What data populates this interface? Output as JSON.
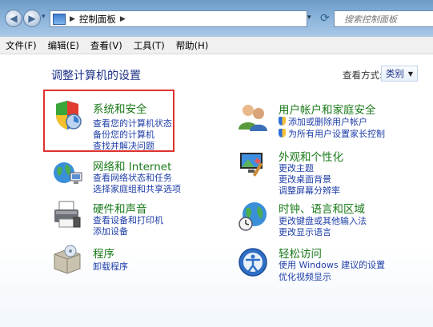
{
  "address": {
    "crumb": "控制面板"
  },
  "search": {
    "placeholder": "搜索控制面板"
  },
  "menubar": [
    "文件(F)",
    "编辑(E)",
    "查看(V)",
    "工具(T)",
    "帮助(H)"
  ],
  "page": {
    "title": "调整计算机的设置",
    "view_by_label": "查看方式:",
    "view_by_value": "类别"
  },
  "categories": {
    "system_security": {
      "title": "系统和安全",
      "links": [
        "查看您的计算机状态",
        "备份您的计算机",
        "查找并解决问题"
      ]
    },
    "network": {
      "title": "网络和 Internet",
      "links": [
        "查看网络状态和任务",
        "选择家庭组和共享选项"
      ]
    },
    "hardware": {
      "title": "硬件和声音",
      "links": [
        "查看设备和打印机",
        "添加设备"
      ]
    },
    "programs": {
      "title": "程序",
      "links": [
        "卸载程序"
      ]
    },
    "user_accounts": {
      "title": "用户帐户和家庭安全",
      "links": [
        "添加或删除用户帐户",
        "为所有用户设置家长控制"
      ]
    },
    "appearance": {
      "title": "外观和个性化",
      "links": [
        "更改主题",
        "更改桌面背景",
        "调整屏幕分辨率"
      ]
    },
    "clock_region": {
      "title": "时钟、语言和区域",
      "links": [
        "更改键盘或其他输入法",
        "更改显示语言"
      ]
    },
    "ease_access": {
      "title": "轻松访问",
      "links": [
        "使用 Windows 建议的设置",
        "优化视频显示"
      ]
    }
  },
  "icons": {
    "back": "back-arrow-icon",
    "forward": "forward-arrow-icon",
    "refresh": "refresh-icon",
    "search": "search-icon"
  }
}
